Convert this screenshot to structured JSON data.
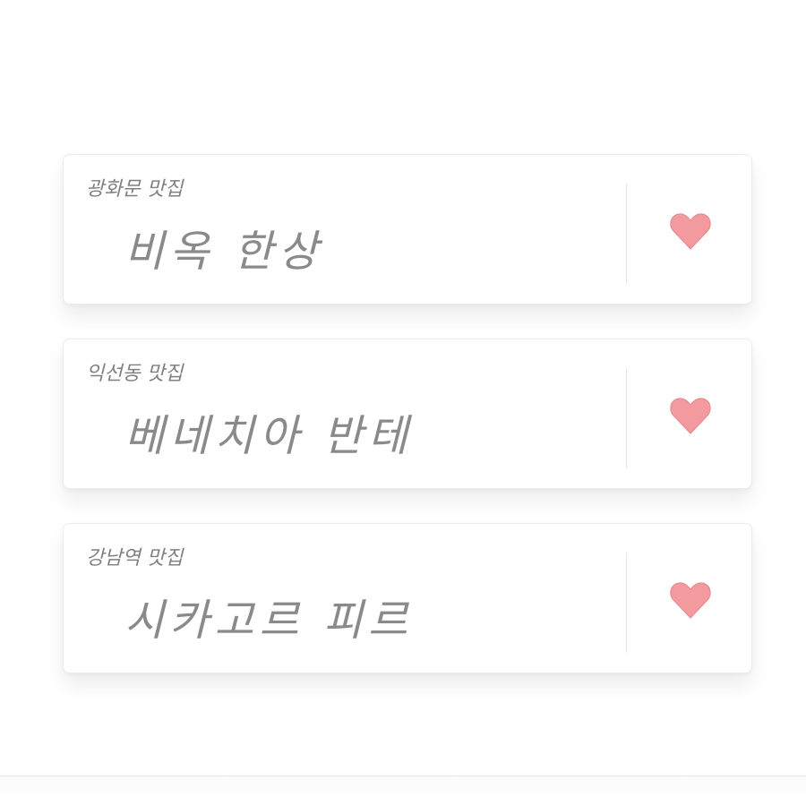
{
  "restaurants": [
    {
      "area": "광화문 맛집",
      "name": "비옥 한상",
      "liked": true
    },
    {
      "area": "익선동 맛집",
      "name": "베네치아 반테",
      "liked": true
    },
    {
      "area": "강남역 맛집",
      "name": "시카고르 피르",
      "liked": true
    }
  ],
  "colors": {
    "heart": "#f29a9e",
    "heart_stroke": "#e5878c",
    "text": "#808080"
  },
  "icons": {
    "like": "heart-icon"
  }
}
